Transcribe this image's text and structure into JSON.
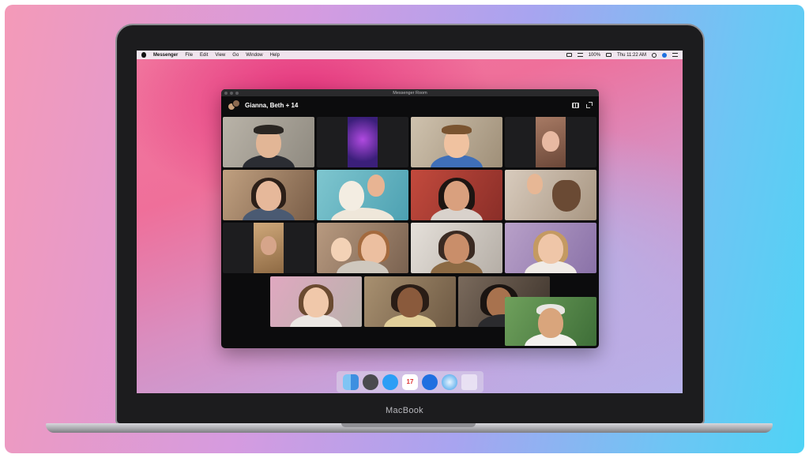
{
  "menubar": {
    "app_name": "Messenger",
    "menus": [
      "File",
      "Edit",
      "View",
      "Go",
      "Window",
      "Help"
    ],
    "battery": "100%",
    "clock": "Thu 11:22 AM"
  },
  "window": {
    "title": "Messenger Room",
    "call_title": "Gianna, Beth + 14"
  },
  "device": {
    "brand": "MacBook"
  },
  "colors": {
    "end_call": "#e8313b",
    "window_bg": "#0c0c0d",
    "messenger_blue": "#1f6fe0"
  },
  "controls": [
    {
      "name": "share-screen-button",
      "icon": "share-screen-icon"
    },
    {
      "name": "participants-button",
      "icon": "people-icon"
    },
    {
      "name": "camera-button",
      "icon": "video-camera-icon"
    },
    {
      "name": "mic-button",
      "icon": "microphone-icon"
    },
    {
      "name": "end-call-button",
      "icon": "hang-up-icon"
    }
  ],
  "dock_items": [
    "finder-icon",
    "system-preferences-icon",
    "messages-icon",
    "calendar-icon",
    "messenger-icon",
    "safari-icon",
    "trash-icon"
  ],
  "calendar_day": "17"
}
